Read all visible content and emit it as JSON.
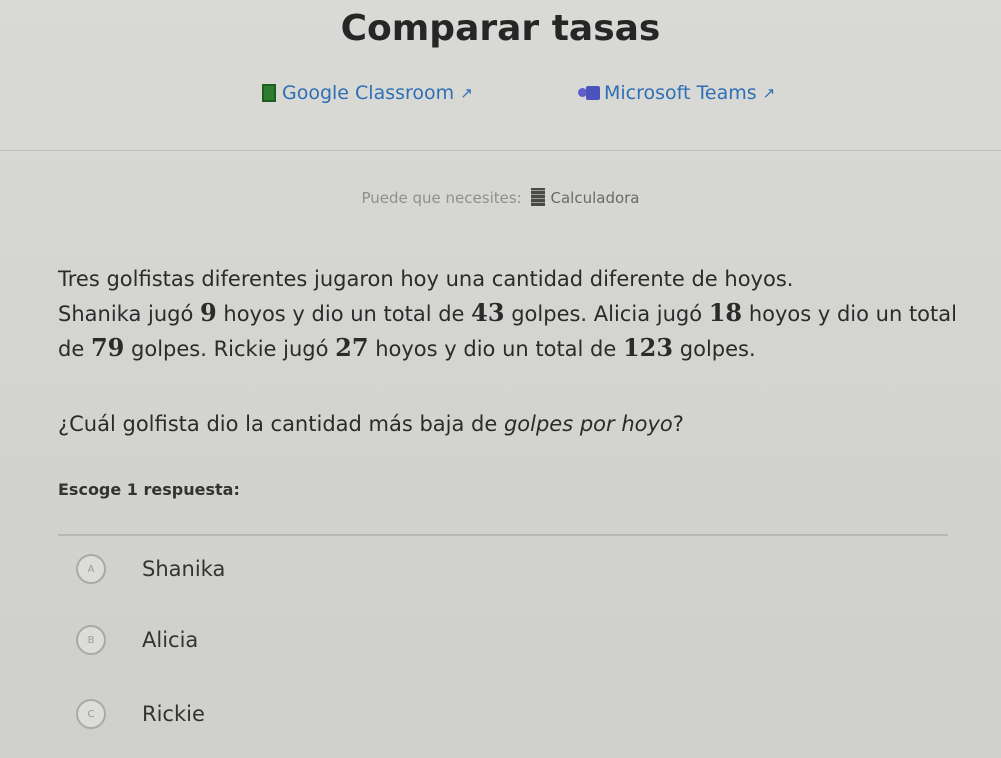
{
  "page": {
    "title": "Comparar tasas"
  },
  "share": {
    "classroom_label": "Google Classroom",
    "teams_label": "Microsoft Teams",
    "external_icon": "↗"
  },
  "calculator": {
    "prefix": "Puede que necesites:",
    "label": "Calculadora"
  },
  "problem": {
    "line1": "Tres golfistas diferentes jugaron hoy una cantidad diferente de hoyos.",
    "seg1": "Shanika jugó ",
    "n1": "9",
    "seg2": " hoyos y dio un total de ",
    "n2": "43",
    "seg3": " golpes. Alicia jugó ",
    "n3": "18",
    "seg4": " hoyos y dio un total de ",
    "n4": "79",
    "seg5": " golpes. Rickie jugó ",
    "n5": "27",
    "seg6": " hoyos y dio un total de ",
    "n6": "123",
    "seg7": " golpes."
  },
  "question": {
    "prefix": "¿Cuál golfista dio la cantidad más baja de ",
    "emphasis": "golpes por hoyo",
    "suffix": "?"
  },
  "answer": {
    "instruction": "Escoge 1 respuesta:",
    "choices": [
      {
        "letter": "A",
        "label": "Shanika"
      },
      {
        "letter": "B",
        "label": "Alicia"
      },
      {
        "letter": "C",
        "label": "Rickie"
      }
    ]
  },
  "colors": {
    "link": "#2f6fb5",
    "background": "#d2d2ce",
    "text": "#2b2b2b"
  }
}
